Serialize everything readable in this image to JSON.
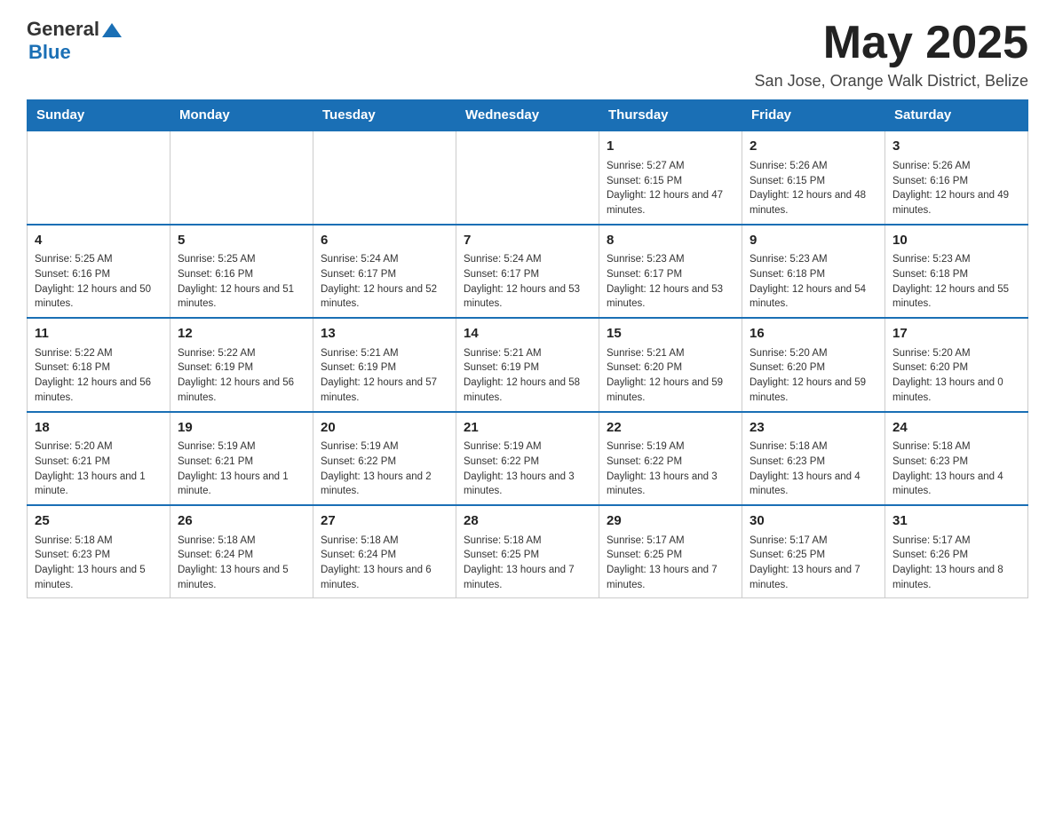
{
  "header": {
    "logo_general": "General",
    "logo_blue": "Blue",
    "month_title": "May 2025",
    "location": "San Jose, Orange Walk District, Belize"
  },
  "days_header": [
    "Sunday",
    "Monday",
    "Tuesday",
    "Wednesday",
    "Thursday",
    "Friday",
    "Saturday"
  ],
  "weeks": [
    [
      {
        "day": "",
        "info": ""
      },
      {
        "day": "",
        "info": ""
      },
      {
        "day": "",
        "info": ""
      },
      {
        "day": "",
        "info": ""
      },
      {
        "day": "1",
        "info": "Sunrise: 5:27 AM\nSunset: 6:15 PM\nDaylight: 12 hours and 47 minutes."
      },
      {
        "day": "2",
        "info": "Sunrise: 5:26 AM\nSunset: 6:15 PM\nDaylight: 12 hours and 48 minutes."
      },
      {
        "day": "3",
        "info": "Sunrise: 5:26 AM\nSunset: 6:16 PM\nDaylight: 12 hours and 49 minutes."
      }
    ],
    [
      {
        "day": "4",
        "info": "Sunrise: 5:25 AM\nSunset: 6:16 PM\nDaylight: 12 hours and 50 minutes."
      },
      {
        "day": "5",
        "info": "Sunrise: 5:25 AM\nSunset: 6:16 PM\nDaylight: 12 hours and 51 minutes."
      },
      {
        "day": "6",
        "info": "Sunrise: 5:24 AM\nSunset: 6:17 PM\nDaylight: 12 hours and 52 minutes."
      },
      {
        "day": "7",
        "info": "Sunrise: 5:24 AM\nSunset: 6:17 PM\nDaylight: 12 hours and 53 minutes."
      },
      {
        "day": "8",
        "info": "Sunrise: 5:23 AM\nSunset: 6:17 PM\nDaylight: 12 hours and 53 minutes."
      },
      {
        "day": "9",
        "info": "Sunrise: 5:23 AM\nSunset: 6:18 PM\nDaylight: 12 hours and 54 minutes."
      },
      {
        "day": "10",
        "info": "Sunrise: 5:23 AM\nSunset: 6:18 PM\nDaylight: 12 hours and 55 minutes."
      }
    ],
    [
      {
        "day": "11",
        "info": "Sunrise: 5:22 AM\nSunset: 6:18 PM\nDaylight: 12 hours and 56 minutes."
      },
      {
        "day": "12",
        "info": "Sunrise: 5:22 AM\nSunset: 6:19 PM\nDaylight: 12 hours and 56 minutes."
      },
      {
        "day": "13",
        "info": "Sunrise: 5:21 AM\nSunset: 6:19 PM\nDaylight: 12 hours and 57 minutes."
      },
      {
        "day": "14",
        "info": "Sunrise: 5:21 AM\nSunset: 6:19 PM\nDaylight: 12 hours and 58 minutes."
      },
      {
        "day": "15",
        "info": "Sunrise: 5:21 AM\nSunset: 6:20 PM\nDaylight: 12 hours and 59 minutes."
      },
      {
        "day": "16",
        "info": "Sunrise: 5:20 AM\nSunset: 6:20 PM\nDaylight: 12 hours and 59 minutes."
      },
      {
        "day": "17",
        "info": "Sunrise: 5:20 AM\nSunset: 6:20 PM\nDaylight: 13 hours and 0 minutes."
      }
    ],
    [
      {
        "day": "18",
        "info": "Sunrise: 5:20 AM\nSunset: 6:21 PM\nDaylight: 13 hours and 1 minute."
      },
      {
        "day": "19",
        "info": "Sunrise: 5:19 AM\nSunset: 6:21 PM\nDaylight: 13 hours and 1 minute."
      },
      {
        "day": "20",
        "info": "Sunrise: 5:19 AM\nSunset: 6:22 PM\nDaylight: 13 hours and 2 minutes."
      },
      {
        "day": "21",
        "info": "Sunrise: 5:19 AM\nSunset: 6:22 PM\nDaylight: 13 hours and 3 minutes."
      },
      {
        "day": "22",
        "info": "Sunrise: 5:19 AM\nSunset: 6:22 PM\nDaylight: 13 hours and 3 minutes."
      },
      {
        "day": "23",
        "info": "Sunrise: 5:18 AM\nSunset: 6:23 PM\nDaylight: 13 hours and 4 minutes."
      },
      {
        "day": "24",
        "info": "Sunrise: 5:18 AM\nSunset: 6:23 PM\nDaylight: 13 hours and 4 minutes."
      }
    ],
    [
      {
        "day": "25",
        "info": "Sunrise: 5:18 AM\nSunset: 6:23 PM\nDaylight: 13 hours and 5 minutes."
      },
      {
        "day": "26",
        "info": "Sunrise: 5:18 AM\nSunset: 6:24 PM\nDaylight: 13 hours and 5 minutes."
      },
      {
        "day": "27",
        "info": "Sunrise: 5:18 AM\nSunset: 6:24 PM\nDaylight: 13 hours and 6 minutes."
      },
      {
        "day": "28",
        "info": "Sunrise: 5:18 AM\nSunset: 6:25 PM\nDaylight: 13 hours and 7 minutes."
      },
      {
        "day": "29",
        "info": "Sunrise: 5:17 AM\nSunset: 6:25 PM\nDaylight: 13 hours and 7 minutes."
      },
      {
        "day": "30",
        "info": "Sunrise: 5:17 AM\nSunset: 6:25 PM\nDaylight: 13 hours and 7 minutes."
      },
      {
        "day": "31",
        "info": "Sunrise: 5:17 AM\nSunset: 6:26 PM\nDaylight: 13 hours and 8 minutes."
      }
    ]
  ]
}
